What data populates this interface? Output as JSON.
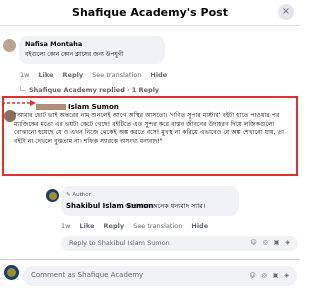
{
  "header": {
    "title": "Shafique Academy's Post",
    "close_icon": "×"
  },
  "comments": [
    {
      "author": "Nafisa Montaha",
      "text": "বইগুলো কোন কোন ক্লাসের জন্য উপযুগী",
      "time": "1w",
      "like": "Like",
      "reply": "Reply",
      "translation": "See translation",
      "hide": "Hide"
    }
  ],
  "replies_link": "Shafique Academy replied · 1 Reply",
  "highlighted": {
    "author": "Islam Sumon",
    "text": "\"আমার ছোট ভাই অন্তরের নাম শুনলেই আগে অস্থির আসতো। 'গণিত সুপার মাস্টার' বইটা হাতে পাওয়ার পর ম্যাজিকের মতো এর ভয়টা কেটে গেছে! বইটিতে এত সুন্দর করে বাস্তব জীবনের উদাহরণ দিয়ে লজিকগুলো বোঝানো হয়েছে যে ও এখন নিজে থেকেই অঙ্ক করতে বসে! মুখস্থ না করিয়ে এভাবেও যে অঙ্ক শেখানো যায়, তা বইটা না দেখলে বুঝতাম না। শফিক স্যারকে অসংখ্য ধন্যবাদ!\""
  },
  "author_reply": {
    "badge": "Author",
    "author": "Shakibul Islam Sumon",
    "text": "আপনাকে অনেক ধন্যবাদ স্যার।",
    "time": "1w",
    "like": "Like",
    "reply": "Reply",
    "translation": "See translation",
    "hide": "Hide"
  },
  "reply_input": {
    "placeholder": "Reply to Shakibul Islam Sumon"
  },
  "comment_input": {
    "placeholder": "Comment as Shafique Academy"
  },
  "colors": {
    "highlight": "#e03131",
    "bubble": "#f0f2f5",
    "muted": "#65676b"
  }
}
